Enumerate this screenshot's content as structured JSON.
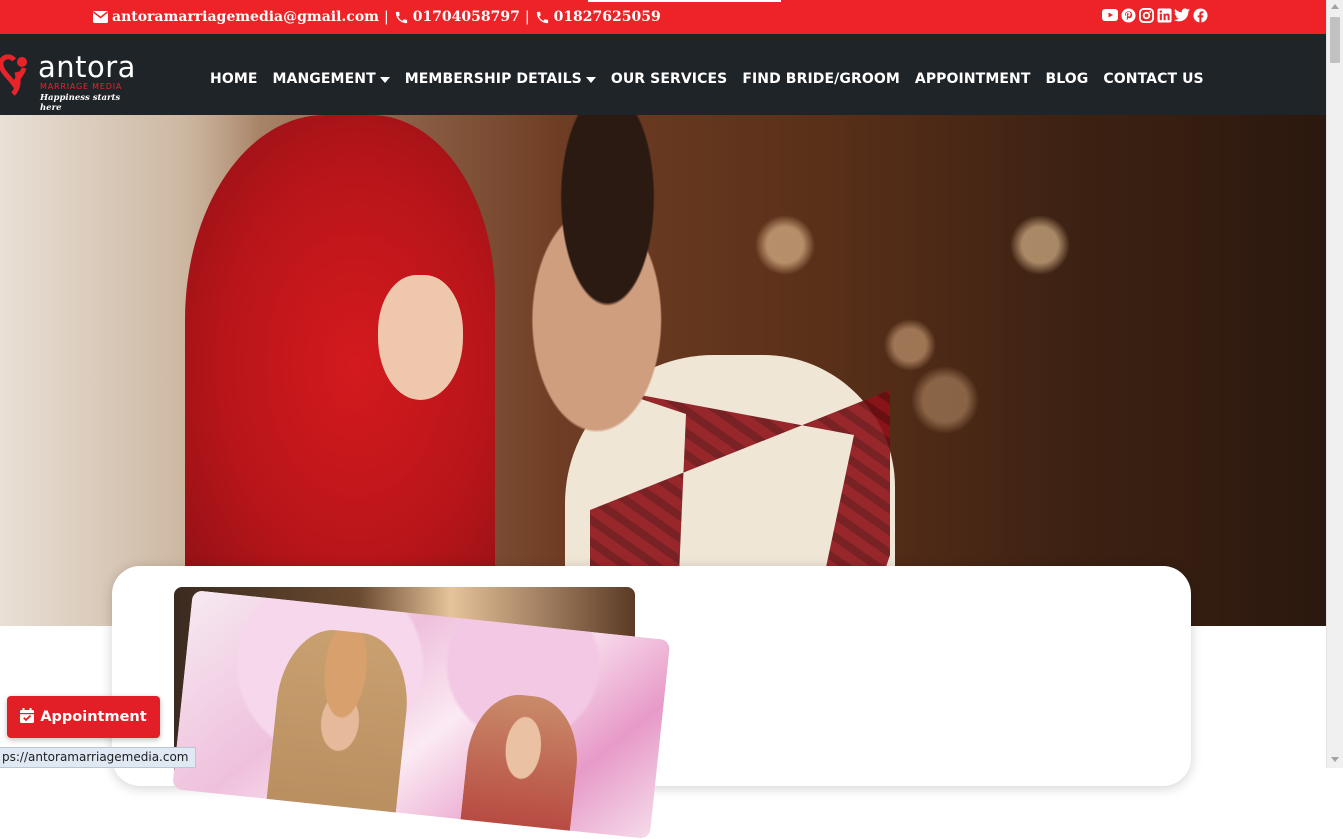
{
  "topbar": {
    "email": "antoramarriagemedia@gmail.com",
    "separator": "|",
    "phone1": "01704058797",
    "phone2": "01827625059",
    "social": [
      "youtube-icon",
      "pinterest-icon",
      "instagram-icon",
      "linkedin-icon",
      "twitter-icon",
      "facebook-icon"
    ]
  },
  "logo": {
    "brand": "antora",
    "subtitle": "MARRIAGE MEDIA",
    "tagline": "Happiness starts here"
  },
  "nav": {
    "items": [
      {
        "label": "HOME",
        "dropdown": false
      },
      {
        "label": "MANGEMENT",
        "dropdown": true
      },
      {
        "label": "MEMBERSHIP DETAILS",
        "dropdown": true
      },
      {
        "label": "OUR SERVICES",
        "dropdown": false
      },
      {
        "label": "FIND BRIDE/GROOM",
        "dropdown": false
      },
      {
        "label": "APPOINTMENT",
        "dropdown": false
      },
      {
        "label": "BLOG",
        "dropdown": false
      },
      {
        "label": "CONTACT US",
        "dropdown": false
      }
    ]
  },
  "floating": {
    "appointment_label": "Appointment"
  },
  "status": {
    "url": "ps://antoramarriagemedia.com"
  },
  "colors": {
    "brand_red": "#ee2328",
    "nav_bg": "#1f2429",
    "button_red": "#e21f26"
  }
}
